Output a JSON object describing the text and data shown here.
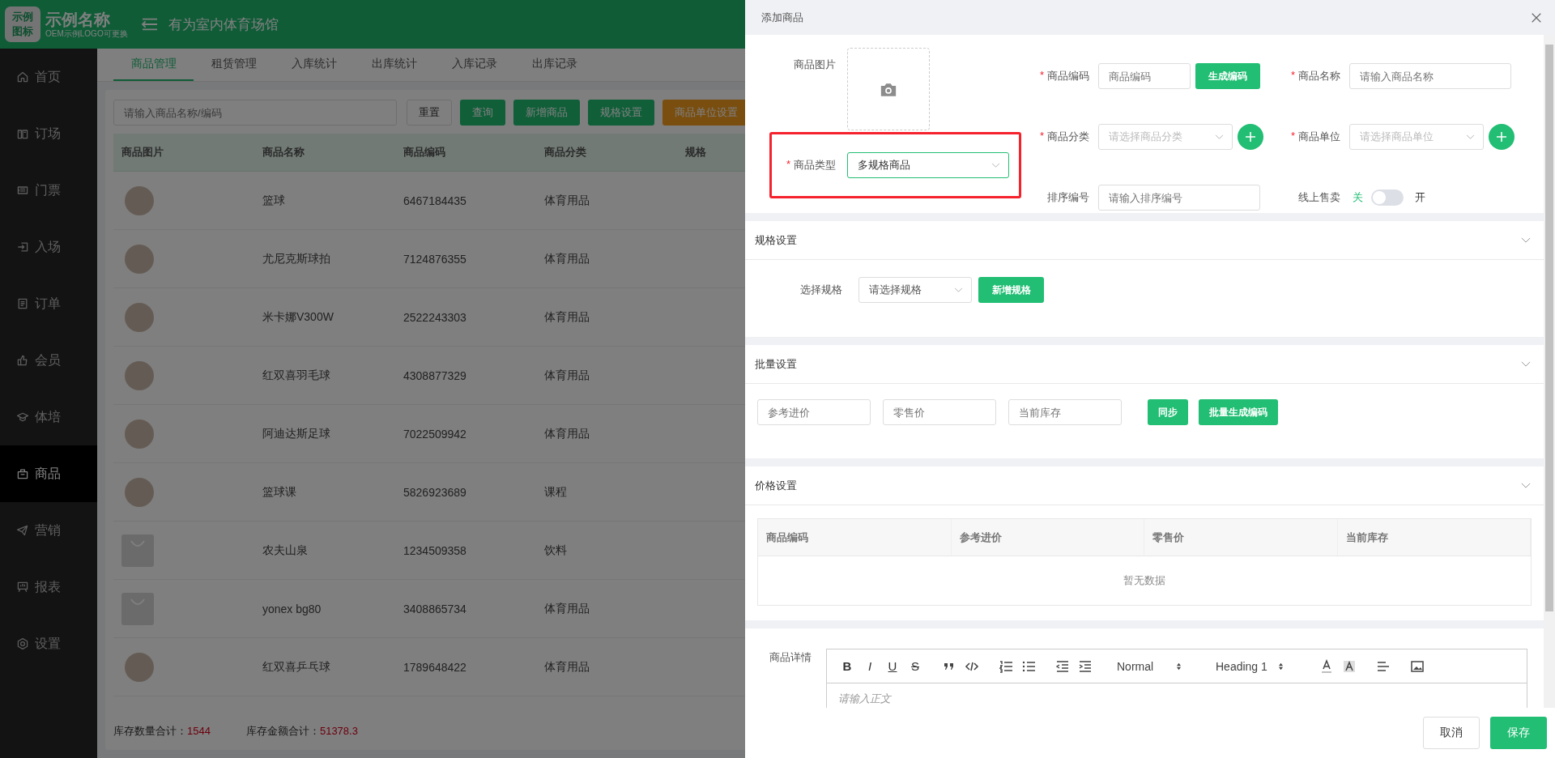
{
  "header": {
    "logo_badge": "示例图标",
    "brand": "示例名称",
    "brand_sub": "OEM示例LOGO可更换",
    "venue": "有为室内体育场馆"
  },
  "sidebar": {
    "items": [
      {
        "label": "首页",
        "selected": false
      },
      {
        "label": "订场",
        "selected": false
      },
      {
        "label": "门票",
        "selected": false
      },
      {
        "label": "入场",
        "selected": false
      },
      {
        "label": "订单",
        "selected": false
      },
      {
        "label": "会员",
        "selected": false
      },
      {
        "label": "体培",
        "selected": false
      },
      {
        "label": "商品",
        "selected": true
      },
      {
        "label": "营销",
        "selected": false
      },
      {
        "label": "报表",
        "selected": false
      },
      {
        "label": "设置",
        "selected": false
      }
    ]
  },
  "tabs": [
    {
      "label": "商品管理",
      "selected": true
    },
    {
      "label": "租赁管理",
      "selected": false
    },
    {
      "label": "入库统计",
      "selected": false
    },
    {
      "label": "出库统计",
      "selected": false
    },
    {
      "label": "入库记录",
      "selected": false
    },
    {
      "label": "出库记录",
      "selected": false
    }
  ],
  "toolbar": {
    "search_placeholder": "请输入商品名称/编码",
    "buttons": [
      {
        "label": "重置",
        "kind": "plain"
      },
      {
        "label": "查询",
        "kind": "primary"
      },
      {
        "label": "新增商品",
        "kind": "primary"
      },
      {
        "label": "规格设置",
        "kind": "primary"
      },
      {
        "label": "商品单位设置",
        "kind": "warning"
      }
    ]
  },
  "table": {
    "columns": [
      "商品图片",
      "商品名称",
      "商品编码",
      "商品分类",
      "规格"
    ],
    "rows": [
      {
        "kind": "photo",
        "name": "篮球",
        "code": "6467184435",
        "category": "体育用品"
      },
      {
        "kind": "photo",
        "name": "尤尼克斯球拍",
        "code": "7124876355",
        "category": "体育用品"
      },
      {
        "kind": "photo",
        "name": "米卡娜V300W",
        "code": "2522243303",
        "category": "体育用品"
      },
      {
        "kind": "photo",
        "name": "红双喜羽毛球",
        "code": "4308877329",
        "category": "体育用品"
      },
      {
        "kind": "photo",
        "name": "阿迪达斯足球",
        "code": "7022509942",
        "category": "体育用品"
      },
      {
        "kind": "photo",
        "name": "篮球课",
        "code": "5826923689",
        "category": "课程"
      },
      {
        "kind": "empty",
        "name": "农夫山泉",
        "code": "1234509358",
        "category": "饮料"
      },
      {
        "kind": "empty",
        "name": "yonex bg80",
        "code": "3408865734",
        "category": "体育用品"
      },
      {
        "kind": "photo",
        "name": "红双喜乒乓球",
        "code": "1789648422",
        "category": "体育用品"
      }
    ]
  },
  "totals": [
    {
      "label": "库存数量合计：",
      "value": "1544"
    },
    {
      "label": "库存金额合计：",
      "value": "51378.3"
    }
  ],
  "drawer": {
    "title": "添加商品",
    "image_label": "商品图片",
    "type": {
      "label": "商品类型",
      "mark": "*",
      "value": "多规格商品",
      "highlighted": true
    },
    "code": {
      "label": "商品编码",
      "mark": "*",
      "placeholder": "商品编码",
      "button": "生成编码"
    },
    "name": {
      "label": "商品名称",
      "mark": "*",
      "placeholder": "请输入商品名称"
    },
    "category": {
      "label": "商品分类",
      "mark": "*",
      "placeholder": "请选择商品分类"
    },
    "unit": {
      "label": "商品单位",
      "mark": "*",
      "placeholder": "请选择商品单位"
    },
    "sort": {
      "label": "排序编号",
      "placeholder": "请输入排序编号"
    },
    "online": {
      "label": "线上售卖",
      "off_label": "关",
      "on_label": "开",
      "on": false
    },
    "spec": {
      "title": "规格设置",
      "select_label": "选择规格",
      "select_value": "请选择规格",
      "button": "新增规格"
    },
    "batch": {
      "title": "批量设置",
      "placeholders": [
        "参考进价",
        "零售价",
        "当前库存"
      ],
      "buttons": [
        "同步",
        "批量生成编码"
      ]
    },
    "price": {
      "title": "价格设置",
      "columns": [
        "商品编码",
        "参考进价",
        "零售价",
        "当前库存"
      ],
      "empty": "暂无数据"
    },
    "detail": {
      "label": "商品详情",
      "format_buttons": [
        "B",
        "I",
        "U",
        "S"
      ],
      "format": "Normal",
      "heading": "Heading 1",
      "placeholder": "请输入正文"
    },
    "footer_buttons": [
      {
        "label": "取消",
        "kind": "plain"
      },
      {
        "label": "保存",
        "kind": "primary"
      }
    ]
  }
}
